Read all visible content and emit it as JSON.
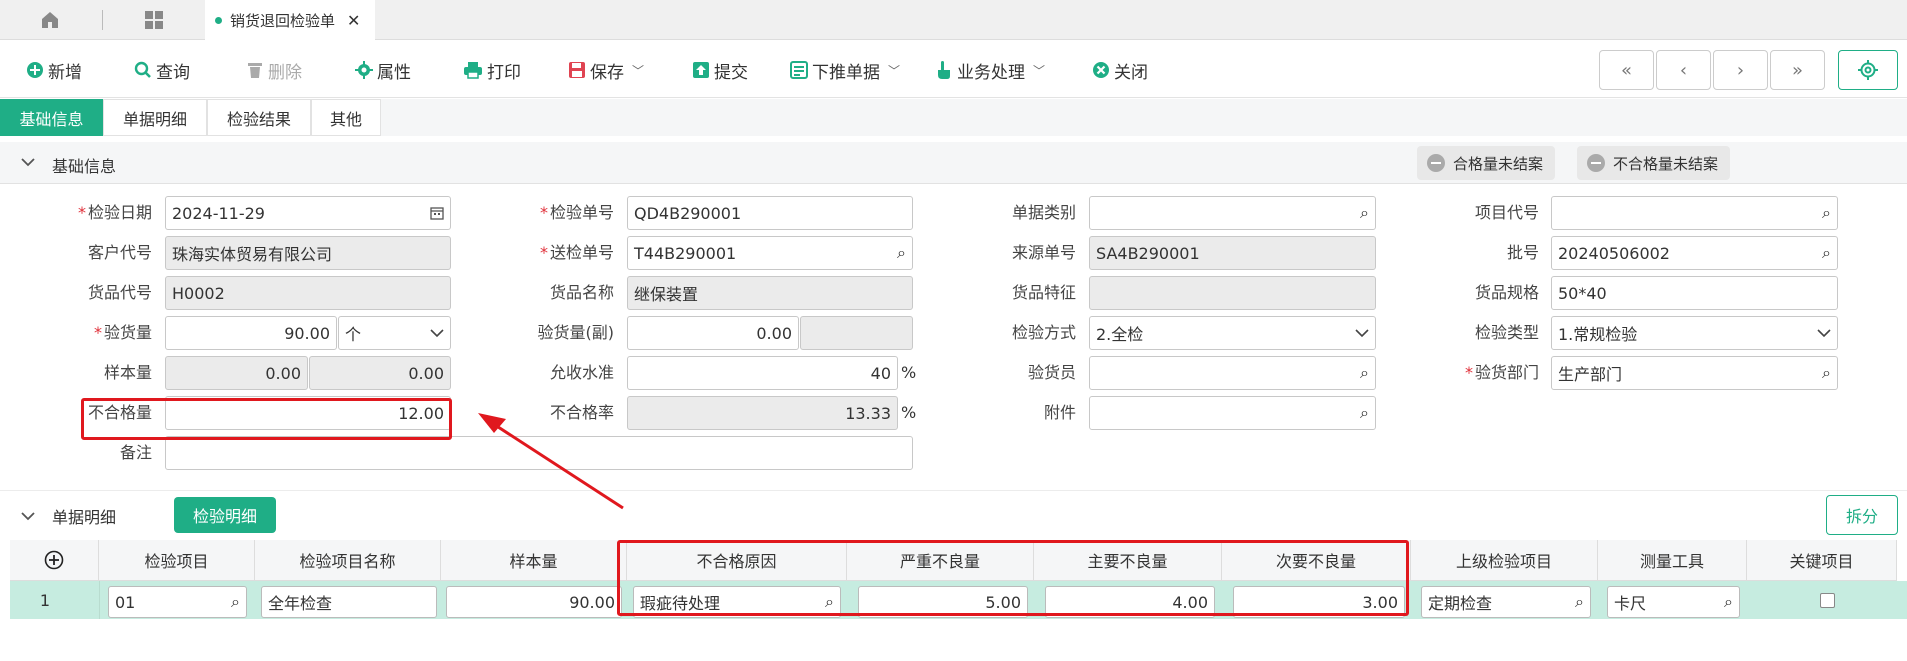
{
  "tabs": {
    "active_label": "销货退回检验单"
  },
  "toolbar": {
    "new": "新增",
    "query": "查询",
    "delete": "删除",
    "properties": "属性",
    "print": "打印",
    "save": "保存",
    "submit": "提交",
    "push": "下推单据",
    "business": "业务处理",
    "close": "关闭"
  },
  "subtabs": [
    "基础信息",
    "单据明细",
    "检验结果",
    "其他"
  ],
  "section_basic": {
    "title": "基础信息",
    "btn_qualified": "合格量未结案",
    "btn_unqualified": "不合格量未结案"
  },
  "form": {
    "inspect_date_label": "检验日期",
    "inspect_date": "2024-11-29",
    "inspect_no_label": "检验单号",
    "inspect_no": "QD4B290001",
    "doc_type_label": "单据类别",
    "doc_type": "",
    "project_code_label": "项目代号",
    "project_code": "",
    "customer_label": "客户代号",
    "customer": "珠海实体贸易有限公司",
    "send_no_label": "送检单号",
    "send_no": "T44B290001",
    "source_no_label": "来源单号",
    "source_no": "SA4B290001",
    "batch_label": "批号",
    "batch": "20240506002",
    "goods_code_label": "货品代号",
    "goods_code": "H0002",
    "goods_name_label": "货品名称",
    "goods_name": "继保装置",
    "goods_feature_label": "货品特征",
    "goods_feature": "",
    "goods_spec_label": "货品规格",
    "goods_spec": "50*40",
    "qty_label": "验货量",
    "qty": "90.00",
    "unit": "个",
    "qty_sub_label": "验货量(副)",
    "qty_sub": "0.00",
    "qty_sub_unit": "",
    "method_label": "检验方式",
    "method": "2.全检",
    "type_label": "检验类型",
    "type": "1.常规检验",
    "sample_label": "样本量",
    "sample1": "0.00",
    "sample2": "0.00",
    "accept_label": "允收水准",
    "accept": "40",
    "pct": "%",
    "inspector_label": "验货员",
    "inspector": "",
    "dept_label": "验货部门",
    "dept": "生产部门",
    "unqualified_label": "不合格量",
    "unqualified": "12.00",
    "rate_label": "不合格率",
    "rate": "13.33",
    "attach_label": "附件",
    "attach": "",
    "remark_label": "备注",
    "remark": ""
  },
  "section_detail": {
    "title": "单据明细",
    "tab": "检验明细",
    "split": "拆分"
  },
  "grid": {
    "headers": [
      "检验项目",
      "检验项目名称",
      "样本量",
      "不合格原因",
      "严重不良量",
      "主要不良量",
      "次要不良量",
      "上级检验项目",
      "测量工具",
      "关键项目"
    ],
    "row": {
      "num": "1",
      "item": "01",
      "item_name": "全年检查",
      "sample": "90.00",
      "reason": "瑕疵待处理",
      "critical": "5.00",
      "major": "4.00",
      "minor": "3.00",
      "parent": "定期检查",
      "tool": "卡尺",
      "key": false
    }
  },
  "colors": {
    "accent": "#1fae86",
    "highlight": "#e0181e",
    "row_selected": "#c6ece0"
  }
}
